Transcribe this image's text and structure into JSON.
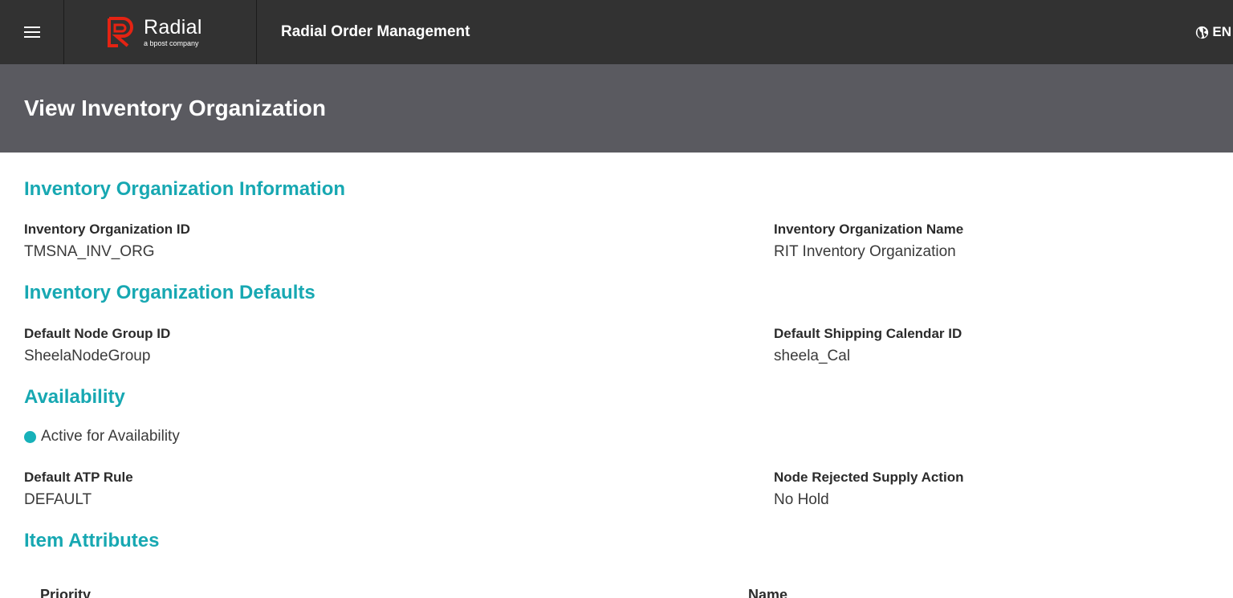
{
  "header": {
    "logo_name": "Radial",
    "logo_sub": "a bpost company",
    "app_title": "Radial Order Management",
    "language": "EN"
  },
  "page": {
    "title": "View Inventory Organization"
  },
  "sections": {
    "info": {
      "title": "Inventory Organization Information",
      "id_label": "Inventory Organization ID",
      "id_value": "TMSNA_INV_ORG",
      "name_label": "Inventory Organization Name",
      "name_value": "RIT Inventory Organization"
    },
    "defaults": {
      "title": "Inventory Organization Defaults",
      "node_group_label": "Default Node Group ID",
      "node_group_value": "SheelaNodeGroup",
      "calendar_label": "Default Shipping Calendar ID",
      "calendar_value": "sheela_Cal"
    },
    "availability": {
      "title": "Availability",
      "status_text": "Active for Availability",
      "status_color": "#17b1b9",
      "atp_label": "Default ATP Rule",
      "atp_value": "DEFAULT",
      "rejected_label": "Node Rejected Supply Action",
      "rejected_value": "No Hold"
    },
    "item_attributes": {
      "title": "Item Attributes",
      "columns": [
        "Priority",
        "Name"
      ]
    }
  },
  "colors": {
    "accent": "#17a8b2",
    "topbar": "#323232",
    "page_header": "#5a5a60",
    "brand_red": "#e42313"
  }
}
